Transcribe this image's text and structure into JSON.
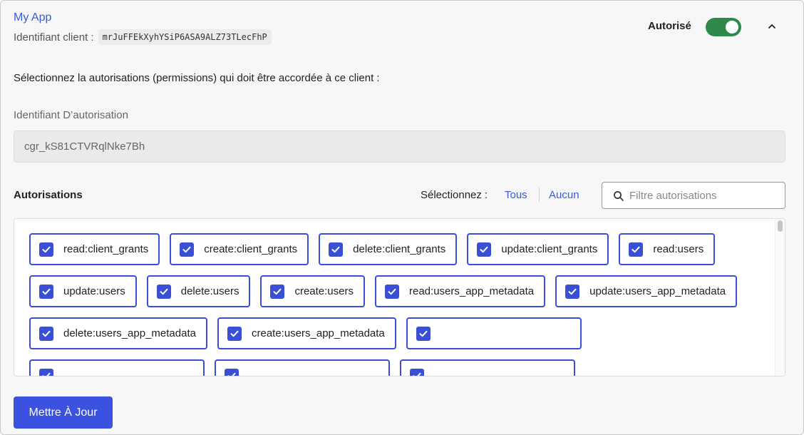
{
  "app": {
    "name": "My App",
    "client_id_label": "Identifiant client :",
    "client_id_value": "mrJuFFEkXyhYSiP6ASA9ALZ73TLecFhP"
  },
  "authorization": {
    "label": "Autorisé",
    "enabled": true,
    "toggle_color": "#2e8a4a"
  },
  "instruction": "Sélectionnez la autorisations (permissions) qui doit être accordée à ce client :",
  "grant": {
    "label": "Identifiant D’autorisation",
    "value": "cgr_kS81CTVRqlNke7Bh"
  },
  "permissions": {
    "title": "Autorisations",
    "select_label": "Sélectionnez :",
    "select_all": "Tous",
    "select_none": "Aucun",
    "filter_placeholder": "Filtre autorisations",
    "items": [
      {
        "label": "read:client_grants",
        "checked": true
      },
      {
        "label": "create:client_grants",
        "checked": true
      },
      {
        "label": "delete:client_grants",
        "checked": true
      },
      {
        "label": "update:client_grants",
        "checked": true
      },
      {
        "label": "read:users",
        "checked": true
      },
      {
        "label": "update:users",
        "checked": true
      },
      {
        "label": "delete:users",
        "checked": true
      },
      {
        "label": "create:users",
        "checked": true
      },
      {
        "label": "read:users_app_metadata",
        "checked": true
      },
      {
        "label": "update:users_app_metadata",
        "checked": true
      },
      {
        "label": "delete:users_app_metadata",
        "checked": true
      },
      {
        "label": "create:users_app_metadata",
        "checked": true
      }
    ],
    "accent_color": "#3b4fd6"
  },
  "update_button": "Mettre À Jour",
  "colors": {
    "link": "#3a5bd9",
    "primary_button": "#3b52e0"
  }
}
